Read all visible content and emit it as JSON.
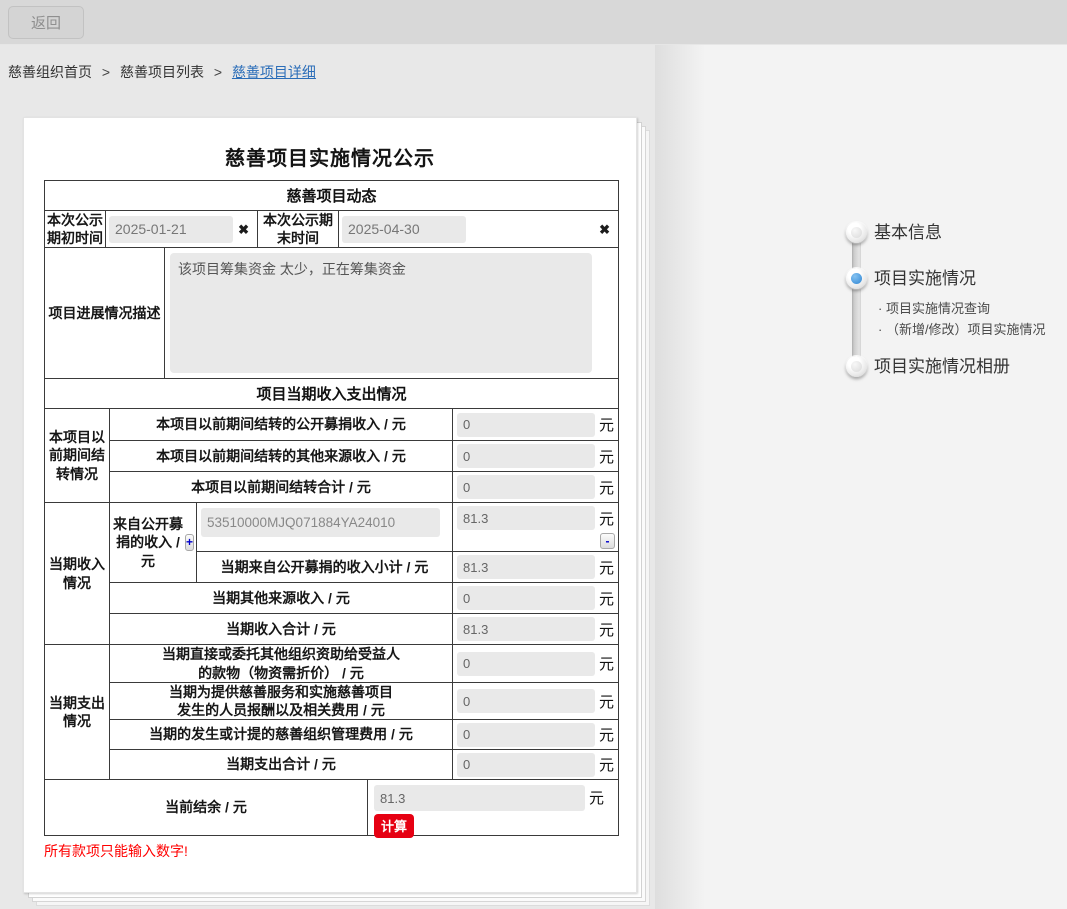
{
  "toolbar": {
    "back_label": "返回"
  },
  "breadcrumb": {
    "items": [
      "慈善组织首页",
      "慈善项目列表",
      "慈善项目详细"
    ],
    "separator": ">"
  },
  "icons": {
    "clear": "✖"
  },
  "colors": {
    "link_blue": "#2a6db8",
    "danger_red": "#e60012",
    "active_step_blue": "#2f86d4",
    "input_gray": "#e9e9e9"
  },
  "form": {
    "title": "慈善项目实施情况公示",
    "dynamics": {
      "header": "慈善项目动态",
      "start_label": "本次公示期初时间",
      "start_value": "2025-01-21",
      "end_label": "本次公示期末时间",
      "end_value": "2025-04-30",
      "desc_label": "项目进展情况描述",
      "desc_value": "该项目筹集资金 太少，正在筹集资金"
    },
    "finance": {
      "header": "项目当期收入支出情况",
      "unit": "元",
      "carryover": {
        "group_label": "本项目以前期间结转情况",
        "rows": [
          {
            "label": "本项目以前期间结转的公开募捐收入 / 元",
            "value": "0"
          },
          {
            "label": "本项目以前期间结转的其他来源收入 / 元",
            "value": "0"
          },
          {
            "label": "本项目以前期间结转合计 / 元",
            "value": "0"
          }
        ]
      },
      "income": {
        "group_label": "当期收入情况",
        "public_label": "来自公开募捐的收入 / 元",
        "add_button": "+",
        "remove_button": "-",
        "donation_code": "53510000MJQ071884YA24010",
        "donation_amount": "81.3",
        "subtotal_label": "当期来自公开募捐的收入小计 / 元",
        "subtotal_value": "81.3",
        "other_label": "当期其他来源收入 / 元",
        "other_value": "0",
        "total_label": "当期收入合计 / 元",
        "total_value": "81.3"
      },
      "expense": {
        "group_label": "当期支出情况",
        "rows": [
          {
            "label": "当期直接或委托其他组织资助给受益人\n的款物（物资需折价） / 元",
            "value": "0"
          },
          {
            "label": "当期为提供慈善服务和实施慈善项目\n发生的人员报酬以及相关费用 / 元",
            "value": "0"
          },
          {
            "label": "当期的发生或计提的慈善组织管理费用 / 元",
            "value": "0"
          },
          {
            "label": "当期支出合计 / 元",
            "value": "0"
          }
        ]
      },
      "balance": {
        "label": "当前结余 / 元",
        "value": "81.3",
        "calc_button": "计算"
      }
    },
    "warning": "所有款项只能输入数字!"
  },
  "stepper": {
    "items": [
      {
        "label": "基本信息"
      },
      {
        "label": "项目实施情况"
      },
      {
        "label": "项目实施情况相册"
      }
    ],
    "sub_items": [
      {
        "label": "· 项目实施情况查询"
      },
      {
        "label": "·  （新增/修改）项目实施情况"
      }
    ]
  }
}
